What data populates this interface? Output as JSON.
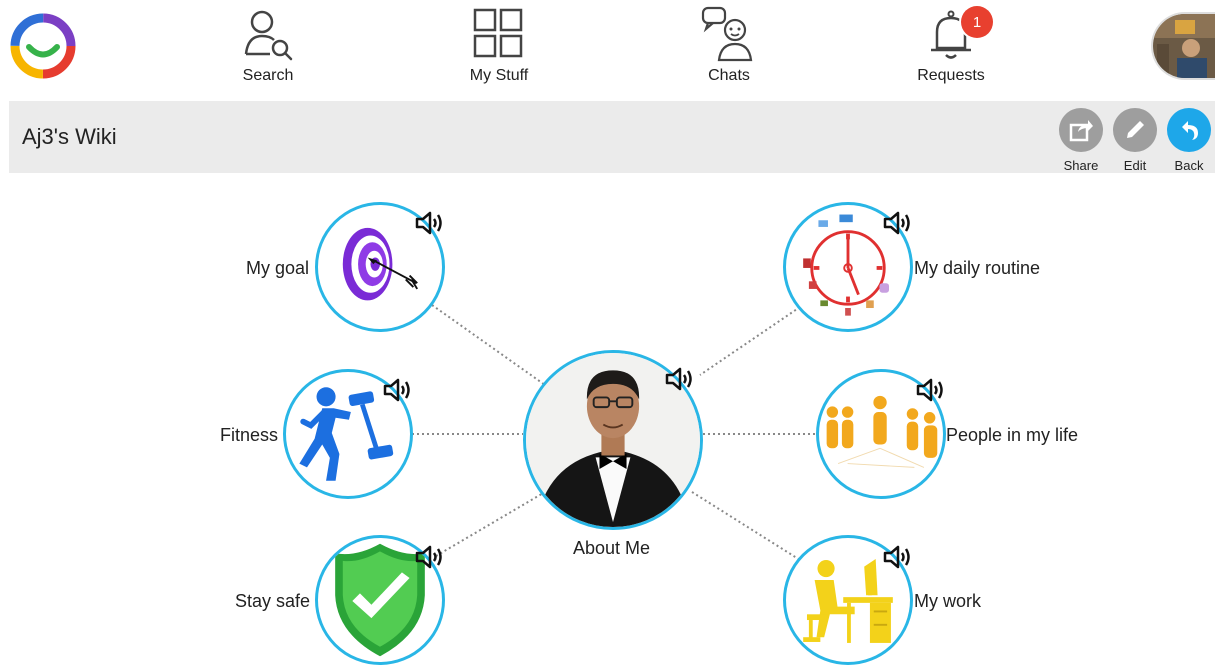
{
  "nav": {
    "search_label": "Search",
    "mystuff_label": "My Stuff",
    "chats_label": "Chats",
    "requests_label": "Requests",
    "requests_badge": "1"
  },
  "header": {
    "title": "Aj3's Wiki",
    "share_label": "Share",
    "edit_label": "Edit",
    "back_label": "Back"
  },
  "wiki": {
    "center_label": "About Me",
    "nodes": [
      {
        "label": "My goal",
        "icon": "target-icon"
      },
      {
        "label": "Fitness",
        "icon": "running-icon"
      },
      {
        "label": "Stay safe",
        "icon": "shield-check-icon"
      },
      {
        "label": "My daily routine",
        "icon": "clock-icon"
      },
      {
        "label": "People in my life",
        "icon": "people-icon"
      },
      {
        "label": "My work",
        "icon": "desk-worker-icon"
      }
    ]
  },
  "colors": {
    "accent": "#29b6e6",
    "badge": "#e8402f",
    "back_button": "#1ea7e9",
    "action_gray": "#9e9e9e"
  }
}
